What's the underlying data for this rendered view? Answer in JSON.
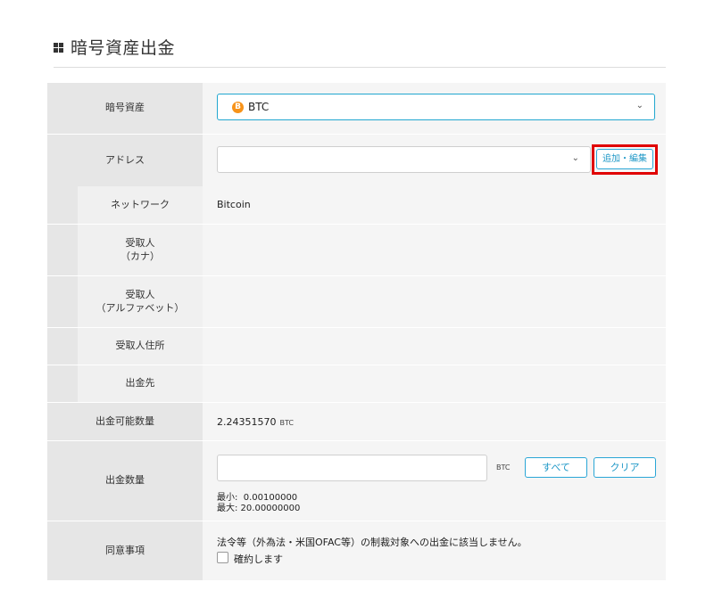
{
  "page": {
    "title": "暗号資産出金"
  },
  "asset_row": {
    "label": "暗号資産",
    "selected_symbol": "BTC",
    "badge_glyph": "B",
    "badge_color": "#f7931a"
  },
  "address_row": {
    "label": "アドレス",
    "selected": "",
    "add_edit_button": "追加・編集"
  },
  "network_row": {
    "label": "ネットワーク",
    "value": "Bitcoin"
  },
  "recipient_kana_row": {
    "label_line1": "受取人",
    "label_line2": "（カナ）",
    "value": ""
  },
  "recipient_alpha_row": {
    "label_line1": "受取人",
    "label_line2": "（アルファベット）",
    "value": ""
  },
  "recipient_address_row": {
    "label": "受取人住所",
    "value": ""
  },
  "destination_row": {
    "label": "出金先",
    "value": ""
  },
  "available_row": {
    "label": "出金可能数量",
    "amount": "2.24351570",
    "unit": "BTC"
  },
  "amount_row": {
    "label": "出金数量",
    "input_value": "",
    "unit": "BTC",
    "all_button": "すべて",
    "clear_button": "クリア",
    "min_text": "最小:  0.00100000",
    "max_text": "最大: 20.00000000"
  },
  "consent_row": {
    "label": "同意事項",
    "statement": "法令等（外為法・米国OFAC等）の制裁対象への出金に該当しません。",
    "checkbox_label": "確約します",
    "checked": false
  },
  "colors": {
    "accent": "#22a7d0",
    "highlight": "#e00000",
    "label_bg": "#e6e6e6",
    "value_bg": "#f5f5f5"
  }
}
